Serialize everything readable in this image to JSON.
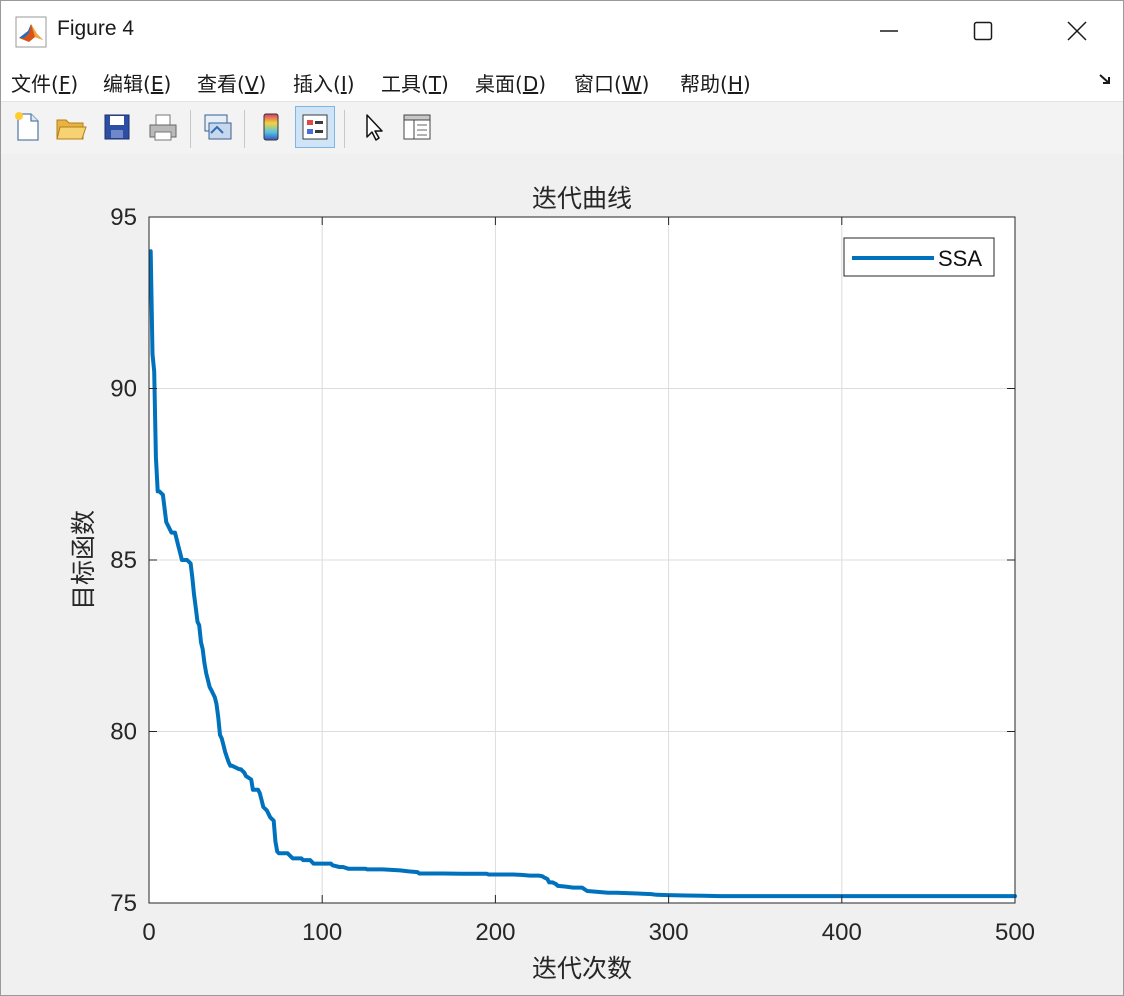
{
  "window": {
    "title": "Figure 4",
    "controls": {
      "minimize": "minimize",
      "maximize": "maximize",
      "close": "close"
    }
  },
  "menu": [
    {
      "label": "文件(",
      "key": "F",
      "tail": ")"
    },
    {
      "label": "编辑(",
      "key": "E",
      "tail": ")"
    },
    {
      "label": "查看(",
      "key": "V",
      "tail": ")"
    },
    {
      "label": "插入(",
      "key": "I",
      "tail": ")"
    },
    {
      "label": "工具(",
      "key": "T",
      "tail": ")"
    },
    {
      "label": "桌面(",
      "key": "D",
      "tail": ")"
    },
    {
      "label": "窗口(",
      "key": "W",
      "tail": ")"
    },
    {
      "label": "帮助(",
      "key": "H",
      "tail": ")"
    }
  ],
  "toolbar": {
    "icons": [
      "new-figure-icon",
      "open-icon",
      "save-icon",
      "print-icon",
      "link-plot-icon",
      "colorbar-icon",
      "legend-icon",
      "edit-plot-icon",
      "property-inspector-icon"
    ],
    "active": "legend-icon"
  },
  "chart_data": {
    "type": "line",
    "title": "迭代曲线",
    "xlabel": "迭代次数",
    "ylabel": "目标函数",
    "xlim": [
      0,
      500
    ],
    "ylim": [
      75,
      95
    ],
    "xticks": [
      "0",
      "100",
      "200",
      "300",
      "400",
      "500"
    ],
    "yticks": [
      "75",
      "80",
      "85",
      "90",
      "95"
    ],
    "grid": true,
    "legend": {
      "position": "top-right",
      "entries": [
        "SSA"
      ]
    },
    "colors": {
      "SSA": "#0072bd"
    },
    "series": [
      {
        "name": "SSA",
        "x": [
          1,
          2,
          3,
          4,
          5,
          6,
          8,
          9,
          10,
          11,
          13,
          14,
          15,
          16,
          17,
          18,
          19,
          20,
          21,
          22,
          24,
          25,
          26,
          27,
          28,
          29,
          30,
          31,
          32,
          33,
          34,
          35,
          36,
          38,
          39,
          40,
          41,
          42,
          43,
          44,
          46,
          47,
          48,
          52,
          53,
          55,
          56,
          59,
          60,
          62,
          63,
          64,
          65,
          66,
          68,
          69,
          70,
          72,
          73,
          74,
          75,
          77,
          78,
          80,
          81,
          82,
          83,
          85,
          88,
          89,
          93,
          94,
          95,
          100,
          105,
          106,
          110,
          112,
          115,
          120,
          125,
          126,
          135,
          145,
          150,
          155,
          156,
          160,
          165,
          170,
          180,
          185,
          190,
          195,
          196,
          200,
          210,
          215,
          220,
          225,
          227,
          228,
          230,
          231,
          233,
          235,
          236,
          240,
          245,
          248,
          250,
          253,
          260,
          265,
          270,
          280,
          285,
          290,
          293,
          300,
          310,
          320,
          330,
          340,
          350,
          400,
          450,
          500
        ],
        "y": [
          94.0,
          91.0,
          90.5,
          88.0,
          87.0,
          87.0,
          86.9,
          86.5,
          86.1,
          86.0,
          85.8,
          85.8,
          85.8,
          85.6,
          85.4,
          85.2,
          85.0,
          85.0,
          85.0,
          85.0,
          84.9,
          84.5,
          84.0,
          83.6,
          83.2,
          83.1,
          82.6,
          82.4,
          82.0,
          81.7,
          81.5,
          81.3,
          81.2,
          81.0,
          80.8,
          80.4,
          79.9,
          79.8,
          79.6,
          79.4,
          79.1,
          79.0,
          79.0,
          78.9,
          78.9,
          78.8,
          78.7,
          78.6,
          78.3,
          78.3,
          78.3,
          78.2,
          78.0,
          77.8,
          77.7,
          77.6,
          77.5,
          77.4,
          76.8,
          76.5,
          76.45,
          76.45,
          76.45,
          76.45,
          76.4,
          76.35,
          76.3,
          76.3,
          76.3,
          76.25,
          76.25,
          76.2,
          76.15,
          76.15,
          76.15,
          76.1,
          76.05,
          76.05,
          76.0,
          76.0,
          76.0,
          75.98,
          75.98,
          75.95,
          75.92,
          75.9,
          75.86,
          75.86,
          75.86,
          75.86,
          75.85,
          75.85,
          75.85,
          75.85,
          75.83,
          75.83,
          75.83,
          75.82,
          75.8,
          75.8,
          75.78,
          75.75,
          75.7,
          75.6,
          75.6,
          75.55,
          75.5,
          75.48,
          75.45,
          75.45,
          75.45,
          75.35,
          75.32,
          75.3,
          75.3,
          75.28,
          75.27,
          75.26,
          75.24,
          75.23,
          75.22,
          75.21,
          75.2,
          75.2,
          75.2,
          75.2,
          75.2,
          75.2
        ]
      }
    ]
  }
}
